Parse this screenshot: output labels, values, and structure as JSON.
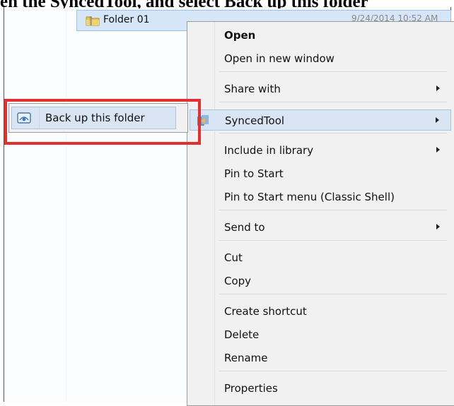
{
  "caption": "en the SyncedTool, and select Back up this folder",
  "explorer": {
    "folder": {
      "name": "Folder 01",
      "modified": "9/24/2014 10:52 AM",
      "icon": "folder-icon"
    }
  },
  "context_menu": {
    "items": [
      {
        "label": "Open",
        "bold": true
      },
      {
        "label": "Open in new window"
      },
      {
        "label": "Share with",
        "submenu": true
      },
      {
        "label": "SyncedTool",
        "submenu": true,
        "highlighted": true,
        "icon": "synced-tool-icon"
      },
      {
        "label": "Include in library",
        "submenu": true
      },
      {
        "label": "Pin to Start"
      },
      {
        "label": "Pin to Start menu (Classic Shell)"
      },
      {
        "label": "Send to",
        "submenu": true
      },
      {
        "label": "Cut"
      },
      {
        "label": "Copy"
      },
      {
        "label": "Create shortcut"
      },
      {
        "label": "Delete"
      },
      {
        "label": "Rename"
      },
      {
        "label": "Properties"
      }
    ]
  },
  "submenu": {
    "item": {
      "label": "Back up this folder",
      "icon": "backup-folder-icon"
    }
  },
  "colors": {
    "highlight": "#dae5f3",
    "selection_border": "#a8c4e6",
    "callout": "#e32f2f"
  }
}
